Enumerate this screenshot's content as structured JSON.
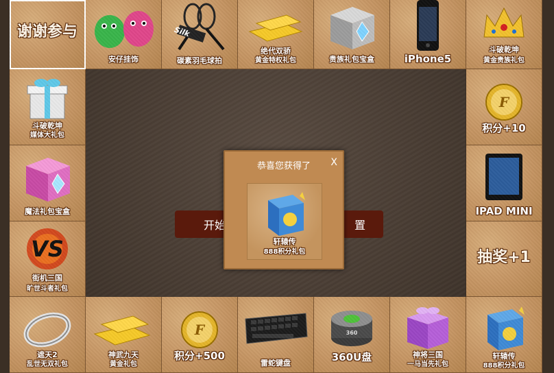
{
  "cells": {
    "c0": {
      "label": "谢谢参与"
    },
    "c1": {
      "label": "安仔挂饰"
    },
    "c2": {
      "label": "碳素羽毛球拍",
      "brand": "Silk"
    },
    "c3": {
      "line1": "绝代双骄",
      "line2": "黄金特权礼包"
    },
    "c4": {
      "label": "贵族礼包宝盒"
    },
    "c5": {
      "label": "iPhone5"
    },
    "c6": {
      "line1": "斗破乾坤",
      "line2": "黄金贵族礼包"
    },
    "r1": {
      "label": "积分+10",
      "coin": "F"
    },
    "r2": {
      "label": "IPAD MINI"
    },
    "r3": {
      "label": "抽奖+1"
    },
    "l1": {
      "line1": "斗破乾坤",
      "line2": "媒体大礼包"
    },
    "l2": {
      "label": "魔法礼包宝盒"
    },
    "l3": {
      "line1": "街机三国",
      "line2": "旷世斗者礼包",
      "emblem": "VS"
    },
    "b0": {
      "line1": "遮天2",
      "line2": "乱世无双礼包"
    },
    "b1": {
      "line1": "神武九天",
      "line2": "黄金礼包"
    },
    "b2": {
      "label": "积分+500",
      "coin": "F"
    },
    "b3": {
      "label": "雷蛇键盘"
    },
    "b4": {
      "label": "360U盘",
      "brand": "360"
    },
    "b5": {
      "line1": "神将三国",
      "line2": "一马当先礼包"
    },
    "b6": {
      "line1": "轩辕传",
      "line2": "888积分礼包"
    }
  },
  "start_button": {
    "left": "开始",
    "right": "置"
  },
  "popup": {
    "title": "恭喜您获得了",
    "close": "X",
    "prize_line1": "轩辕传",
    "prize_line2": "888积分礼包"
  },
  "colors": {
    "cell": "#c59563",
    "center": "#4a3e35",
    "button": "#5a1a0c",
    "popup": "#c08a52"
  }
}
